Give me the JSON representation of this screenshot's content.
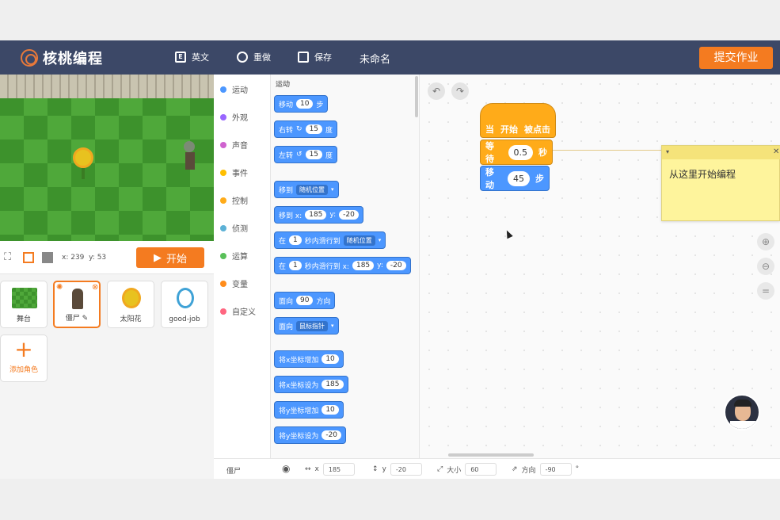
{
  "header": {
    "logo_text": "核桃编程",
    "btn_lang": "英文",
    "btn_redo": "重做",
    "btn_save": "保存",
    "project_name": "未命名",
    "submit": "提交作业"
  },
  "stage": {
    "coord_x": "x: 239",
    "coord_y": "y: 53",
    "start": "开始"
  },
  "sprites": [
    {
      "label": "舞台"
    },
    {
      "label": "僵尸"
    },
    {
      "label": "太阳花"
    },
    {
      "label": "good-job"
    }
  ],
  "add_sprite": "添加角色",
  "categories": [
    {
      "label": "运动",
      "color": "#4c97ff"
    },
    {
      "label": "外观",
      "color": "#9966ff"
    },
    {
      "label": "声音",
      "color": "#cf63cf"
    },
    {
      "label": "事件",
      "color": "#ffbf00"
    },
    {
      "label": "控制",
      "color": "#ffab19"
    },
    {
      "label": "侦测",
      "color": "#5cb1d6"
    },
    {
      "label": "运算",
      "color": "#59c059"
    },
    {
      "label": "变量",
      "color": "#ff8c1a"
    },
    {
      "label": "自定义",
      "color": "#ff6680"
    }
  ],
  "palette": {
    "title": "运动",
    "b1": {
      "a": "移动",
      "v": "10",
      "b": "步"
    },
    "b2": {
      "a": "右转",
      "v": "15",
      "b": "度"
    },
    "b3": {
      "a": "左转",
      "v": "15",
      "b": "度"
    },
    "b4": {
      "a": "移到",
      "dd": "随机位置"
    },
    "b5": {
      "a": "移到 x:",
      "x": "185",
      "ylab": "y:",
      "y": "-20"
    },
    "b6": {
      "a": "在",
      "v": "1",
      "b": "秒内滑行到",
      "dd": "随机位置"
    },
    "b7": {
      "a": "在",
      "v": "1",
      "b": "秒内滑行到 x:",
      "x": "185",
      "ylab": "y:",
      "y": "-20"
    },
    "b8": {
      "a": "面向",
      "v": "90",
      "b": "方向"
    },
    "b9": {
      "a": "面向",
      "dd": "鼠标指针"
    },
    "b10": {
      "a": "将x坐标增加",
      "v": "10"
    },
    "b11": {
      "a": "将x坐标设为",
      "v": "185"
    },
    "b12": {
      "a": "将y坐标增加",
      "v": "10"
    },
    "b13": {
      "a": "将y坐标设为",
      "v": "-20"
    }
  },
  "script": {
    "hat": {
      "a": "当",
      "b": "开始",
      "c": "被点击"
    },
    "wait": {
      "a": "等待",
      "v": "0.5",
      "b": "秒"
    },
    "move": {
      "a": "移动",
      "v": "45",
      "b": "步"
    }
  },
  "note": {
    "text": "从这里开始编程"
  },
  "infobar": {
    "sprite_name": "僵尸",
    "x_label": "x",
    "x_value": "185",
    "y_label": "y",
    "y_value": "-20",
    "size_label": "大小",
    "size_value": "60",
    "dir_label": "方向",
    "dir_value": "-90"
  }
}
